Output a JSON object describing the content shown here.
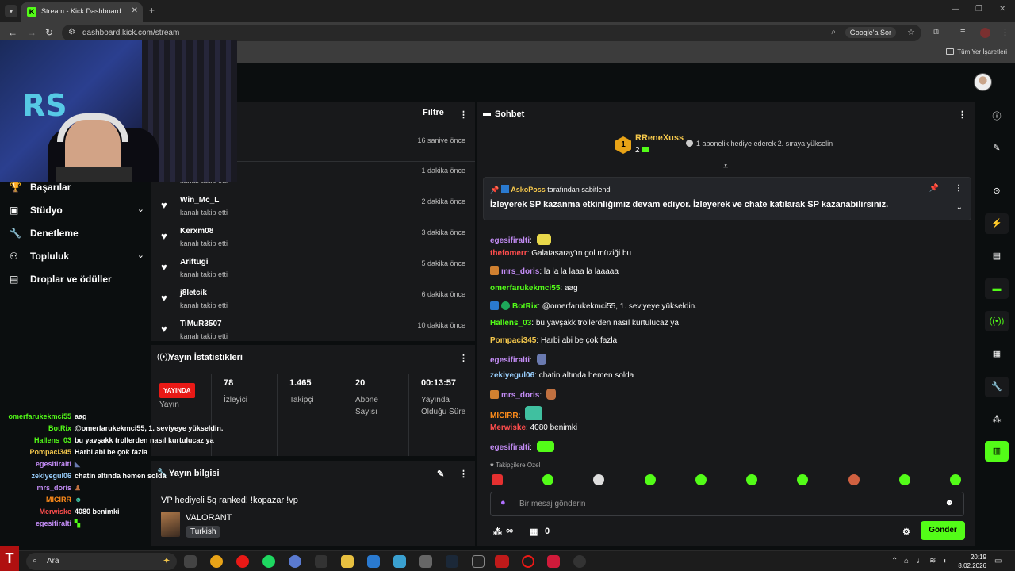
{
  "browser": {
    "tab_title": "Stream - Kick Dashboard",
    "tab_close": "✕",
    "new_tab": "+",
    "url": "dashboard.kick.com/stream",
    "lens_label": "Google'a Sor",
    "bookmarks_label": "Tüm Yer İşaretleri",
    "favicon": "K"
  },
  "sidebar": {
    "items": [
      {
        "label": "Başarılar",
        "icon": "trophy-icon"
      },
      {
        "label": "Stüdyo",
        "icon": "studio-icon"
      },
      {
        "label": "Denetleme",
        "icon": "wrench-icon"
      },
      {
        "label": "Topluluk",
        "icon": "community-icon"
      },
      {
        "label": "Droplar ve ödüller",
        "icon": "drops-icon"
      }
    ]
  },
  "activity": {
    "filter_label": "Filtre",
    "rows": [
      {
        "name": "",
        "sub": "",
        "time": "16 saniye önce"
      },
      {
        "name": "",
        "sub": "kanalı takip etti",
        "time": "1 dakika önce"
      },
      {
        "name": "Win_Mc_L",
        "sub": "kanalı takip etti",
        "time": "2 dakika önce"
      },
      {
        "name": "Kerxm08",
        "sub": "kanalı takip etti",
        "time": "3 dakika önce"
      },
      {
        "name": "Ariftugi",
        "sub": "kanalı takip etti",
        "time": "5 dakika önce"
      },
      {
        "name": "j8letcik",
        "sub": "kanalı takip etti",
        "time": "6 dakika önce"
      },
      {
        "name": "TiMuR3507",
        "sub": "kanalı takip etti",
        "time": "10 dakika önce"
      }
    ]
  },
  "stats": {
    "title": "Yayın İstatistikleri",
    "live_badge": "YAYINDA",
    "live_label": "Yayın",
    "viewers": "78",
    "viewers_label": "İzleyici",
    "followers": "1.465",
    "followers_label": "Takipçi",
    "subs": "20",
    "subs_label": "Abone Sayısı",
    "duration": "00:13:57",
    "duration_label": "Yayında Olduğu Süre"
  },
  "stream_info": {
    "title": "Yayın bilgisi",
    "stream_title": "VP hediyeli 5q ranked! !kopazar !vp",
    "game": "VALORANT",
    "language": "Turkish"
  },
  "chat": {
    "title": "Sohbet",
    "leader": {
      "rank": "1",
      "name": "RReneXuss",
      "count": "2",
      "message": "1 abonelik hediye ederek 2. sıraya yükselin"
    },
    "pinned": {
      "by_user": "AskoPoss",
      "by_suffix": "tarafından sabitlendi",
      "text": "İzleyerek SP kazanma etkinliğimiz devam ediyor. İzleyerek ve chate katılarak SP kazanabilirsiniz."
    },
    "messages": [
      {
        "user": "egesifiralti",
        "color": "#c38cf5",
        "text": ""
      },
      {
        "user": "thefomerr",
        "color": "#ff4d4d",
        "text": "Galatasaray'ın gol müziği bu"
      },
      {
        "user": "mrs_doris",
        "color": "#c38cf5",
        "text": "la la la laaa la laaaaa"
      },
      {
        "user": "omerfarukekmci55",
        "color": "#53fc18",
        "text": "aag"
      },
      {
        "user": "BotRix",
        "color": "#53fc18",
        "text": "@omerfarukekmci55, 1. seviyeye yükseldin."
      },
      {
        "user": "Hallens_03",
        "color": "#53fc18",
        "text": "bu yavşakk trollerden nasıl kurtulucaz ya"
      },
      {
        "user": "Pompaci345",
        "color": "#f5c84c",
        "text": "Harbi abi be çok fazla"
      },
      {
        "user": "egesifiralti",
        "color": "#c38cf5",
        "text": ""
      },
      {
        "user": "zekiyegul06",
        "color": "#9ad0ff",
        "text": "chatin altında hemen solda"
      },
      {
        "user": "mrs_doris",
        "color": "#c38cf5",
        "text": ""
      },
      {
        "user": "MICIRR",
        "color": "#ff8c1a",
        "text": ""
      },
      {
        "user": "Merwiske",
        "color": "#ff4d4d",
        "text": "4080 benimki"
      },
      {
        "user": "egesifiralti",
        "color": "#c38cf5",
        "text": ""
      }
    ],
    "followers_only": "Takipçilere Özel",
    "input_placeholder": "Bir mesaj gönderin",
    "points": "∞",
    "drops_count": "0",
    "send_label": "Gönder"
  },
  "overlay_chat": [
    {
      "user": "omerfarukekmci55",
      "color": "#53fc18",
      "text": "aag"
    },
    {
      "user": "BotRix",
      "color": "#53fc18",
      "text": "@omerfarukekmci55, 1. seviyeye yükseldin."
    },
    {
      "user": "Hallens_03",
      "color": "#53fc18",
      "text": "bu yavşakk trollerden nasıl kurtulucaz ya"
    },
    {
      "user": "Pompaci345",
      "color": "#f5c84c",
      "text": "Harbi abi be çok fazla"
    },
    {
      "user": "egesifiralti",
      "color": "#c38cf5",
      "text": ""
    },
    {
      "user": "zekiyegul06",
      "color": "#9ad0ff",
      "text": "chatin altında hemen solda"
    },
    {
      "user": "mrs_doris",
      "color": "#c38cf5",
      "text": ""
    },
    {
      "user": "MICIRR",
      "color": "#ff8c1a",
      "text": ""
    },
    {
      "user": "Merwiske",
      "color": "#ff4d4d",
      "text": "4080 benimki"
    },
    {
      "user": "egesifiralti",
      "color": "#c38cf5",
      "text": ""
    }
  ],
  "taskbar": {
    "search_label": "Ara",
    "time": "20:19",
    "date": "8.02.2026"
  },
  "colors": {
    "accent": "#53fc18",
    "live": "#e91916",
    "panel": "#18191b"
  }
}
